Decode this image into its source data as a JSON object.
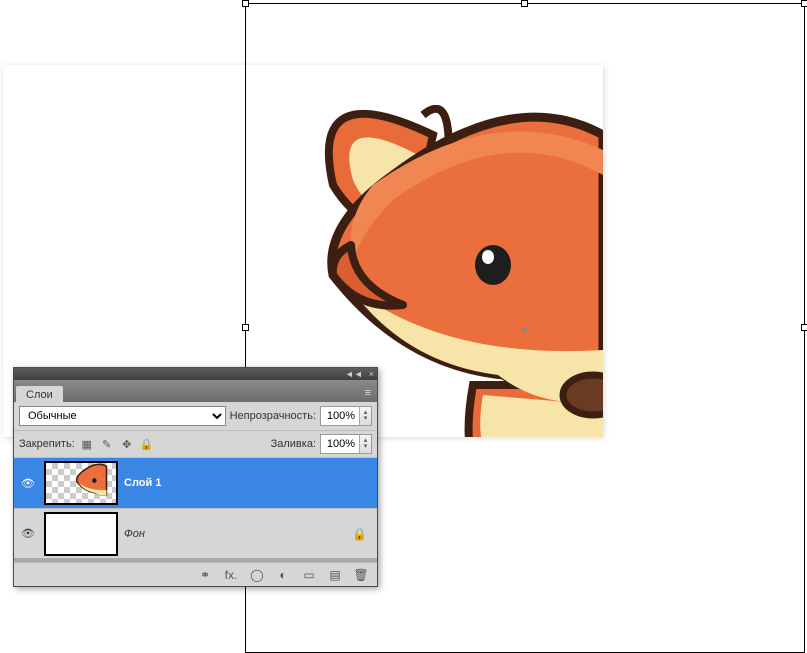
{
  "panel": {
    "title": "Слои",
    "blend_mode": "Обычные",
    "opacity_label": "Непрозрачность:",
    "opacity_value": "100%",
    "lock_label": "Закрепить:",
    "fill_label": "Заливка:",
    "fill_value": "100%"
  },
  "layers": [
    {
      "name": "Слой 1",
      "visible": true,
      "selected": true,
      "locked": false
    },
    {
      "name": "Фон",
      "visible": true,
      "selected": false,
      "locked": true
    }
  ],
  "icons": {
    "menu": "≡",
    "collapse": "◄◄",
    "close": "×",
    "eye": "👁",
    "lock_pixels": "▦",
    "lock_brush": "✎",
    "lock_move": "✥",
    "lock_all": "🔒",
    "link": "⚭",
    "fx": "fx.",
    "mask": "◯",
    "adjust": "◐",
    "folder": "▭",
    "new": "▤",
    "trash": "🗑",
    "lock_small": "🔒"
  }
}
